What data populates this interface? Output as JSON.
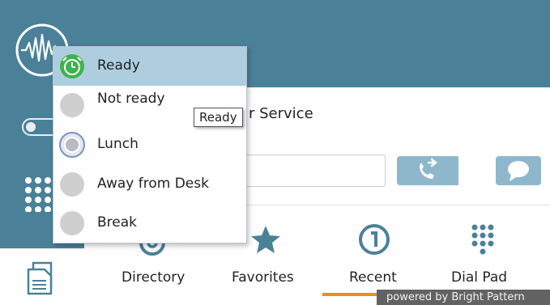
{
  "status_menu": {
    "items": [
      {
        "label": "Ready",
        "icon": "green-clock-icon"
      },
      {
        "label": "Not ready",
        "icon": "gray-circle-icon"
      },
      {
        "label": "Lunch",
        "icon": "lunch-circle-icon"
      },
      {
        "label": "Away from Desk",
        "icon": "gray-circle-icon"
      },
      {
        "label": "Break",
        "icon": "gray-circle-icon"
      }
    ],
    "selected": "Ready"
  },
  "tooltip": {
    "text": "Ready"
  },
  "header": {
    "service_text": "r Service"
  },
  "search": {
    "value": "",
    "placeholder": ""
  },
  "nav": {
    "items": [
      {
        "label": "Directory",
        "icon": "at-icon"
      },
      {
        "label": "Favorites",
        "icon": "star-icon"
      },
      {
        "label": "Recent",
        "icon": "recent-icon"
      },
      {
        "label": "Dial Pad",
        "icon": "dialpad-icon"
      }
    ],
    "active": "Recent"
  },
  "footer": {
    "powered": "powered by Bright Pattern"
  },
  "colors": {
    "sidebar": "#4a8199",
    "button": "#8fb7cb",
    "selected": "#aecee0",
    "accent": "#f28a1c",
    "ready_green": "#3cb44a"
  }
}
